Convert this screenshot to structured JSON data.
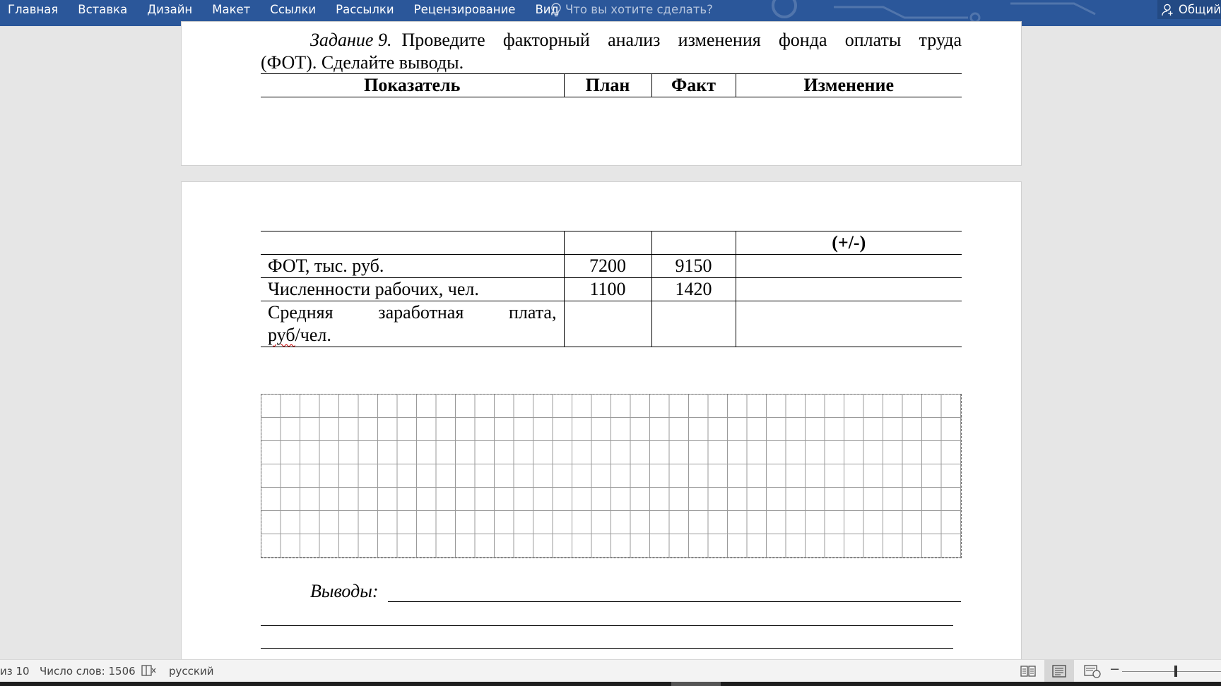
{
  "ribbon": {
    "tabs": [
      "Главная",
      "Вставка",
      "Дизайн",
      "Макет",
      "Ссылки",
      "Рассылки",
      "Рецензирование",
      "Вид"
    ],
    "tell_me_placeholder": "Что вы хотите сделать?",
    "share_label": "Общий"
  },
  "document": {
    "task_label": "Задание 9.",
    "task_text_line1": "Проведите факторный анализ изменения фонда оплаты труда",
    "task_text_line2": "(ФОТ). Сделайте выводы.",
    "table": {
      "headers": [
        "Показатель",
        "План",
        "Факт",
        "Изменение"
      ],
      "header_cont": [
        "",
        "",
        "",
        "(+/-)"
      ],
      "rows": [
        {
          "indicator": "ФОТ, тыс. руб.",
          "plan": "7200",
          "fact": "9150",
          "change": ""
        },
        {
          "indicator": "Численности рабочих, чел.",
          "plan": "1100",
          "fact": "1420",
          "change": ""
        },
        {
          "indicator_words": [
            "Средняя",
            "заработная",
            "плата,"
          ],
          "indicator_line2_a": "руб",
          "indicator_line2_b": "/чел.",
          "plan": "",
          "fact": "",
          "change": ""
        }
      ]
    },
    "conclusions_label": "Выводы:"
  },
  "status_bar": {
    "page": "из 10",
    "word_count": "Число слов: 1506",
    "language": "русский"
  },
  "colors": {
    "ribbon": "#2b579a",
    "page": "#ffffff",
    "background": "#e6e6e6"
  }
}
